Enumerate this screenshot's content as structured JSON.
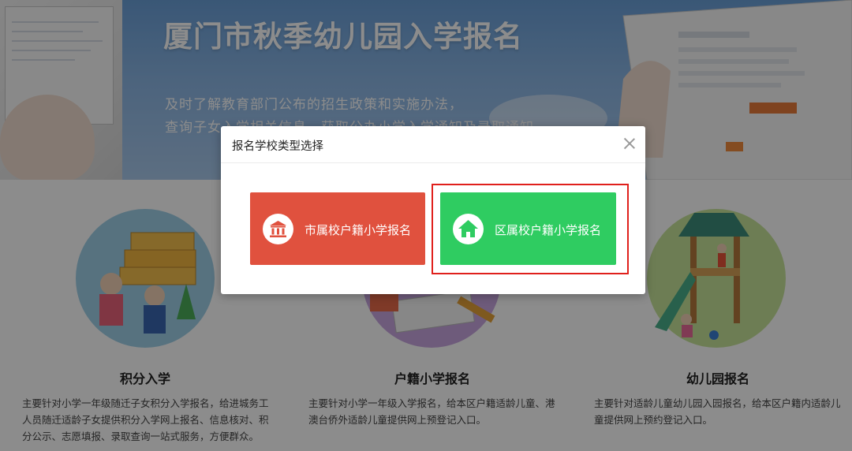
{
  "banner": {
    "title": "厦门市秋季幼儿园入学报名",
    "subtitle_line1": "及时了解教育部门公布的招生政策和实施办法，",
    "subtitle_line2": "查询子女入学相关信息，获取公办小学入学通知及录取通知"
  },
  "services": [
    {
      "title": "积分入学",
      "desc": "主要针对小学一年级随迁子女积分入学报名，给进城务工人员随迁适龄子女提供积分入学网上报名、信息核对、积分公示、志愿填报、录取查询一站式服务，方便群众。"
    },
    {
      "title": "户籍小学报名",
      "desc": "主要针对小学一年级入学报名，给本区户籍适龄儿童、港澳台侨外适龄儿童提供网上预登记入口。"
    },
    {
      "title": "幼儿园报名",
      "desc": "主要针对适龄儿童幼儿园入园报名，给本区户籍内适龄儿童提供网上预约登记入口。"
    }
  ],
  "modal": {
    "title": "报名学校类型选择",
    "option_city": {
      "label": "市属校户籍小学报名",
      "icon": "institution-icon",
      "color": "#e0513e"
    },
    "option_district": {
      "label": "区属校户籍小学报名",
      "icon": "home-icon",
      "color": "#2fcc61"
    },
    "highlight_color": "#e0201c"
  }
}
